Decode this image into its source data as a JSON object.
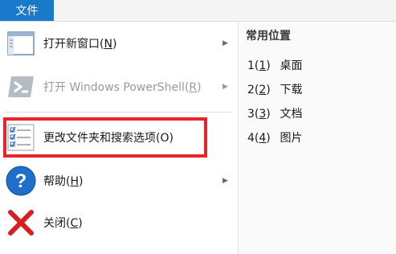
{
  "file_tab": {
    "label": "文件"
  },
  "menu": {
    "items": [
      {
        "label": "打开新窗口(",
        "key": "N",
        "tail": ")",
        "has_submenu": true,
        "enabled": true,
        "icon": "new-window-icon"
      },
      {
        "label": "打开 Windows PowerShell(",
        "key": "R",
        "tail": ")",
        "has_submenu": true,
        "enabled": false,
        "icon": "powershell-icon"
      },
      {
        "label": "更改文件夹和搜索选项(O)",
        "has_submenu": false,
        "enabled": true,
        "icon": "folder-options-icon"
      },
      {
        "label": "帮助(",
        "key": "H",
        "tail": ")",
        "has_submenu": true,
        "enabled": true,
        "icon": "help-icon"
      },
      {
        "label": "关闭(",
        "key": "C",
        "tail": ")",
        "has_submenu": false,
        "enabled": true,
        "icon": "close-icon"
      }
    ],
    "highlight_color": "#e8232a"
  },
  "frequent": {
    "title": "常用位置",
    "items": [
      {
        "num_a": "1(",
        "num_key": "1",
        "num_b": ")",
        "label": "桌面"
      },
      {
        "num_a": "2(",
        "num_key": "2",
        "num_b": ")",
        "label": "下载"
      },
      {
        "num_a": "3(",
        "num_key": "3",
        "num_b": ")",
        "label": "文档"
      },
      {
        "num_a": "4(",
        "num_key": "4",
        "num_b": ")",
        "label": "图片"
      }
    ]
  },
  "colors": {
    "accent": "#1979ca"
  }
}
